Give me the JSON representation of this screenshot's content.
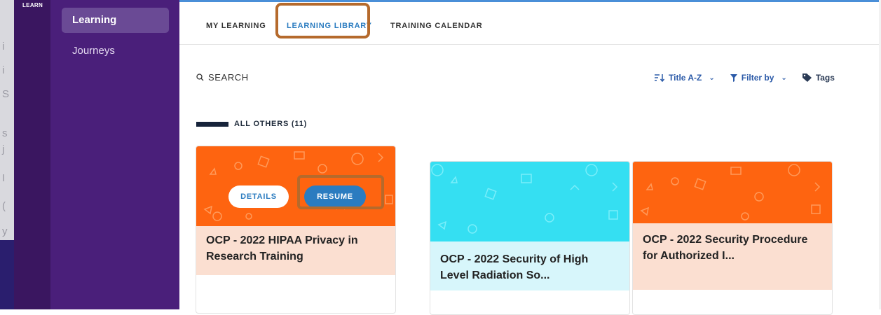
{
  "rail": {
    "label": "LEARN"
  },
  "bg_strip_letters": [
    "i",
    "i",
    "S",
    "s",
    "j",
    "I",
    "(",
    "y"
  ],
  "sidebar": {
    "items": [
      {
        "label": "Learning",
        "active": true
      },
      {
        "label": "Journeys",
        "active": false
      }
    ]
  },
  "tabs": [
    {
      "label": "MY LEARNING",
      "active": false
    },
    {
      "label": "LEARNING LIBRARY",
      "active": true
    },
    {
      "label": "TRAINING CALENDAR",
      "active": false
    }
  ],
  "search": {
    "label": "SEARCH",
    "icon": "search-icon"
  },
  "sort": {
    "label": "Title A-Z",
    "icon": "sort-icon"
  },
  "filter": {
    "label": "Filter by",
    "icon": "filter-icon"
  },
  "tags": {
    "label": "Tags",
    "icon": "tag-icon"
  },
  "section": {
    "title": "ALL OTHERS (11)"
  },
  "cards": [
    {
      "title": "OCP - 2022 HIPAA Privacy in Research Training",
      "header_color": "#fe6410",
      "body_color": "#fbdfd1",
      "details_label": "DETAILS",
      "resume_label": "RESUME"
    },
    {
      "title": "OCP - 2022 Security of High Level Radiation So...",
      "header_color": "#35dff2",
      "body_color": "#d7f6fb"
    },
    {
      "title": "OCP - 2022 Security Procedure for Authorized I...",
      "header_color": "#fe6410",
      "body_color": "#fbdfd1"
    }
  ],
  "colors": {
    "accent": "#2b7cc0",
    "highlight": "#b56a2c",
    "sidebar": "#4a1f7a"
  }
}
